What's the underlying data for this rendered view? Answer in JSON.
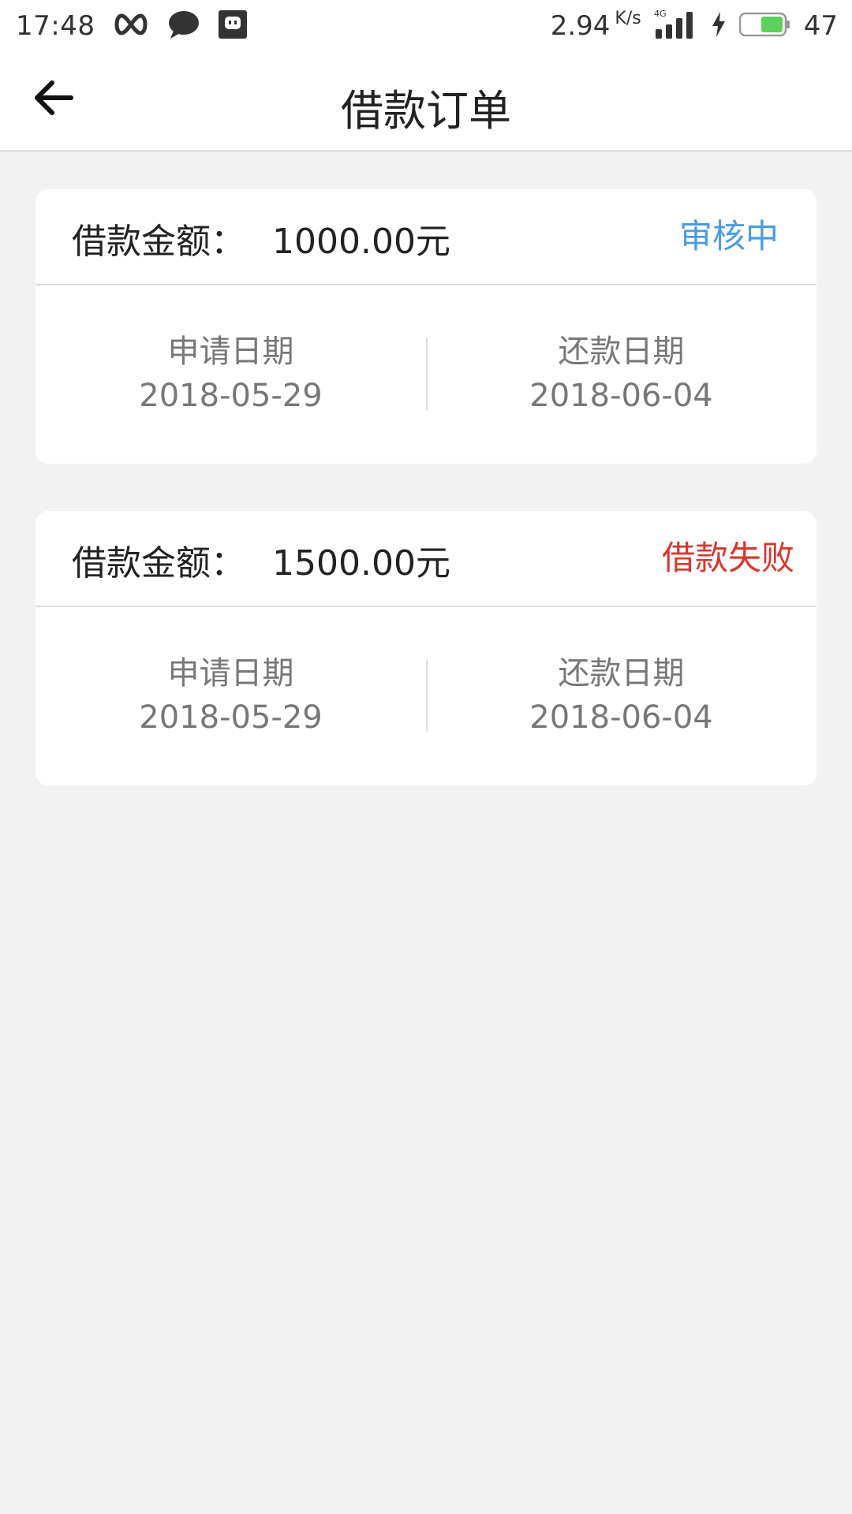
{
  "status_bar": {
    "time": "17:48",
    "net_speed": "2.94",
    "net_speed_unit": "K/s",
    "network_type": "4G",
    "battery_level": "47",
    "icons": [
      "infinity-icon",
      "chat-bubble-icon",
      "app-notification-icon",
      "signal-icon",
      "charging-icon",
      "battery-icon"
    ]
  },
  "nav": {
    "title": "借款订单",
    "back_icon": "back-arrow-icon"
  },
  "orders": [
    {
      "amount_label": "借款金额：",
      "amount": "1000.00元",
      "status": "审核中",
      "status_color": "#4a9be0",
      "apply_label": "申请日期",
      "apply_date": "2018-05-29",
      "repay_label": "还款日期",
      "repay_date": "2018-06-04"
    },
    {
      "amount_label": "借款金额：",
      "amount": "1500.00元",
      "status": "借款失败",
      "status_color": "#d9362c",
      "apply_label": "申请日期",
      "apply_date": "2018-05-29",
      "repay_label": "还款日期",
      "repay_date": "2018-06-04"
    }
  ],
  "colors": {
    "background": "#f2f2f2",
    "card": "#ffffff"
  }
}
